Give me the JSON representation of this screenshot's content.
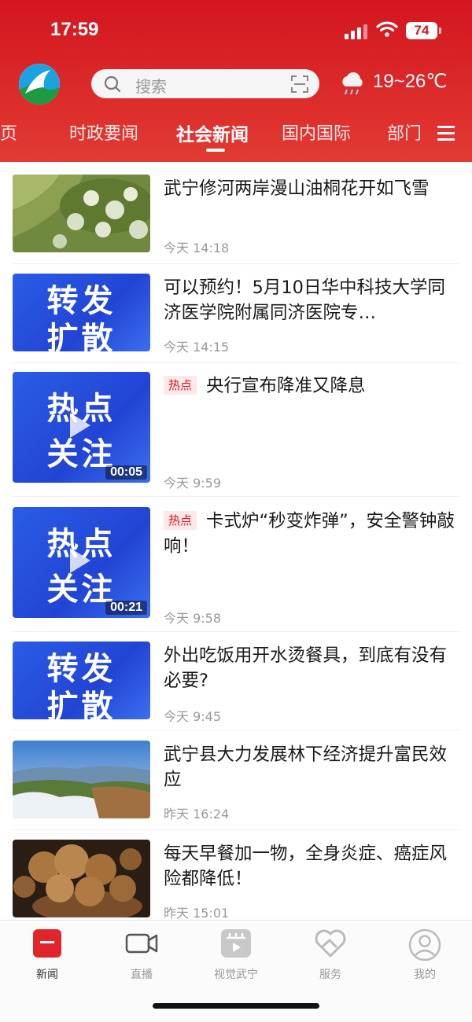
{
  "status_bar": {
    "time": "17:59",
    "battery": "74"
  },
  "header": {
    "search_placeholder": "搜索",
    "weather": "19~26℃",
    "tabs": [
      "首页",
      "时政要闻",
      "社会新闻",
      "国内国际",
      "部门"
    ],
    "active_tab": "社会新闻"
  },
  "news": [
    {
      "title": "武宁修河两岸漫山油桐花开如飞雪",
      "time": "今天  14:18",
      "thumb": "landscape-trees-photo"
    },
    {
      "title": "可以预约！5月10日华中科技大学同济医学院附属同济医院专…",
      "time": "今天  14:15",
      "thumb_text": [
        "转发",
        "扩散"
      ]
    },
    {
      "tag": "热点",
      "title": "央行宣布降准又降息",
      "time": "今天  9:59",
      "thumb_text": [
        "热点",
        "关注"
      ],
      "duration": "00:05"
    },
    {
      "tag": "热点",
      "title": "卡式炉“秒变炸弹”，安全警钟敲响！",
      "time": "今天  9:58",
      "thumb_text": [
        "热点",
        "关注"
      ],
      "duration": "00:21"
    },
    {
      "title": "外出吃饭用开水烫餐具，到底有没有必要?",
      "time": "今天  9:45",
      "thumb_text": [
        "转发",
        "扩散"
      ]
    },
    {
      "title": "武宁县大力发展林下经济提升富民效应",
      "time": "昨天  16:24",
      "thumb": "mountain-clouds-photo"
    },
    {
      "title": "每天早餐加一物，全身炎症、癌症风险都降低！",
      "time": "昨天  15:01",
      "thumb": "walnuts-photo"
    }
  ],
  "bottom_nav": [
    {
      "label": "新闻",
      "icon": "news-icon"
    },
    {
      "label": "直播",
      "icon": "video-camera-icon"
    },
    {
      "label": "视觉武宁",
      "icon": "gallery-icon"
    },
    {
      "label": "服务",
      "icon": "handshake-heart-icon"
    },
    {
      "label": "我的",
      "icon": "user-icon"
    }
  ],
  "colors": {
    "brand_red": "#d3161f",
    "blue_card": "#2548d8"
  }
}
